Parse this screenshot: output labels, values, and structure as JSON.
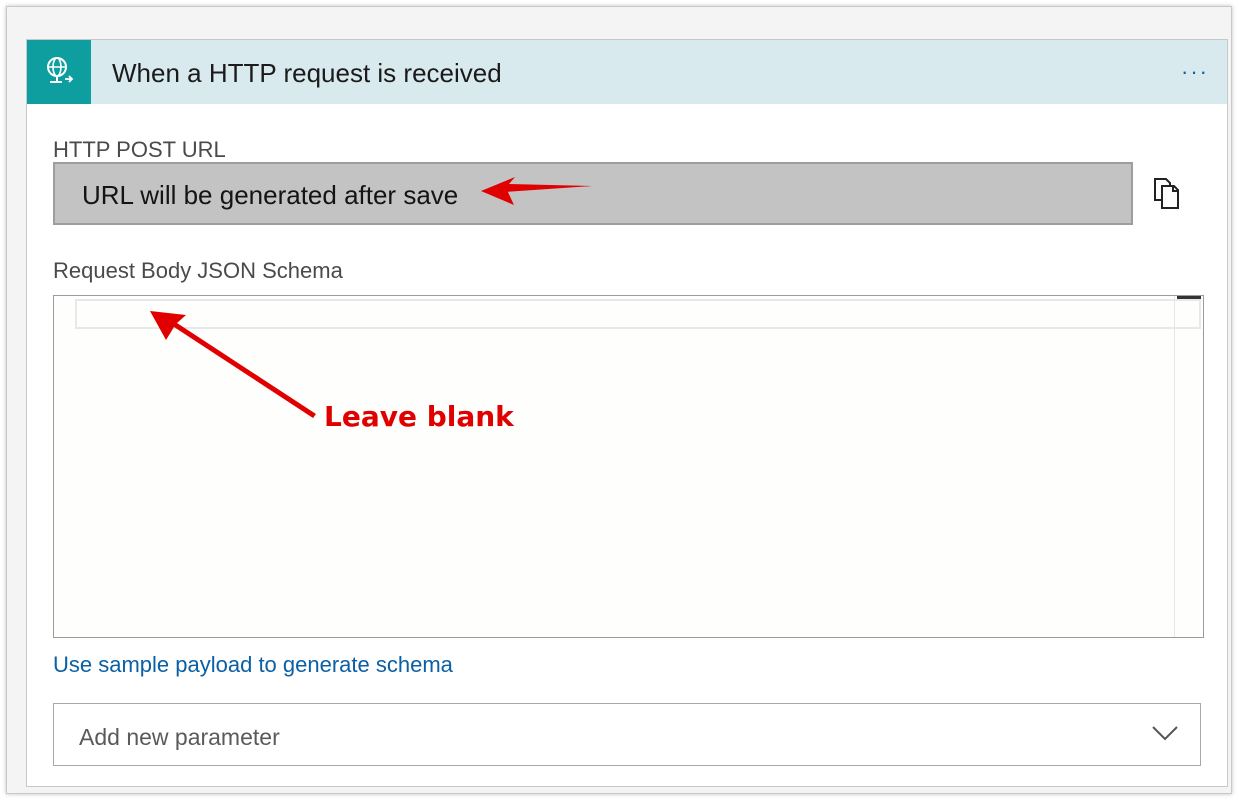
{
  "trigger": {
    "title": "When a HTTP request is received",
    "icon": "globe-request-icon",
    "more_label": "···"
  },
  "url_section": {
    "label": "HTTP POST URL",
    "value": "URL will be generated after save",
    "copy_icon": "copy-icon"
  },
  "schema_section": {
    "label": "Request Body JSON Schema",
    "value": ""
  },
  "links": {
    "sample_payload": "Use sample payload to generate schema"
  },
  "parameters": {
    "placeholder": "Add new parameter",
    "icon": "chevron-down-icon"
  },
  "annotations": {
    "leave_blank": "Leave blank"
  },
  "colors": {
    "header_bg": "#d9eaee",
    "icon_bg": "#0f9ea0",
    "link": "#0b5fa5",
    "annotation": "#e00000",
    "url_field_bg": "#c3c3c3"
  }
}
